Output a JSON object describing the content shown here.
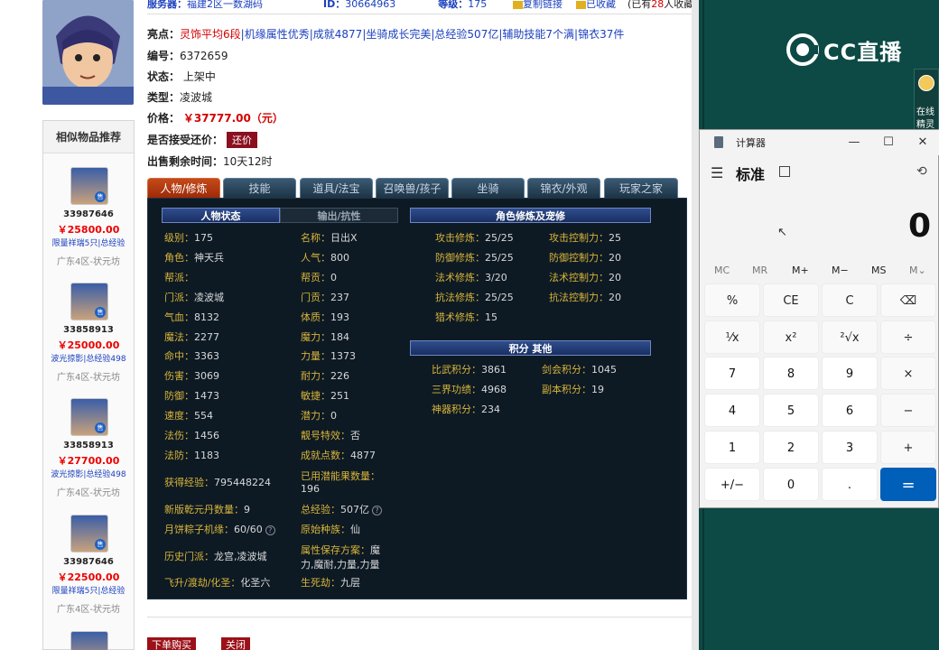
{
  "header": {
    "server_label": "服务器：",
    "server_value": "福建2区一数湖码",
    "id_label": "ID：",
    "id_value": "30664963",
    "level_label": "等级：",
    "level_value": "175",
    "copy_link": "复制链接",
    "favorited": "已收藏",
    "fav_count_prefix": "(已有",
    "fav_count": "28",
    "fav_count_suffix": "人收藏)"
  },
  "item": {
    "highlights_label": "亮点：",
    "highlights": [
      "灵饰平均6段",
      "机缘属性优秀",
      "成就4877",
      "坐骑成长完美",
      "总经验507亿",
      "辅助技能7个满",
      "锦衣37件"
    ],
    "serial_label": "编号：",
    "serial_value": "6372659",
    "status_label": "状态：",
    "status_value": "上架中",
    "type_label": "类型：",
    "type_value": "凌波城",
    "price_label": "价格：",
    "price_value": "￥37777.00（元）",
    "bargain_label": "是否接受还价：",
    "bargain_button": "还价",
    "remaining_label": "出售剩余时间：",
    "remaining_value": "10天12时"
  },
  "tabs": [
    "人物/修炼",
    "技能",
    "道具/法宝",
    "召唤兽/孩子",
    "坐骑",
    "锦衣/外观",
    "玩家之家"
  ],
  "panel": {
    "char_status_header": "人物状态",
    "resist_header": "输出/抗性",
    "cultivation_header": "角色修炼及宠修",
    "score_header": "积分 其他",
    "left_stats": [
      {
        "k": "级别：",
        "v": "175"
      },
      {
        "k": "角色：",
        "v": "神天兵"
      },
      {
        "k": "帮派：",
        "v": ""
      },
      {
        "k": "门派：",
        "v": "凌波城"
      },
      {
        "k": "气血：",
        "v": "8132"
      },
      {
        "k": "魔法：",
        "v": "2277"
      },
      {
        "k": "命中：",
        "v": "3363"
      },
      {
        "k": "伤害：",
        "v": "3069"
      },
      {
        "k": "防御：",
        "v": "1473"
      },
      {
        "k": "速度：",
        "v": "554"
      },
      {
        "k": "法伤：",
        "v": "1456"
      },
      {
        "k": "法防：",
        "v": "1183"
      }
    ],
    "mid_stats": [
      {
        "k": "名称：",
        "v": "日出X"
      },
      {
        "k": "人气：",
        "v": "800"
      },
      {
        "k": "帮贡：",
        "v": "0"
      },
      {
        "k": "门贡：",
        "v": "237"
      },
      {
        "k": "体质：",
        "v": "193"
      },
      {
        "k": "魔力：",
        "v": "184"
      },
      {
        "k": "力量：",
        "v": "1373"
      },
      {
        "k": "耐力：",
        "v": "226"
      },
      {
        "k": "敏捷：",
        "v": "251"
      },
      {
        "k": "潜力：",
        "v": "0"
      },
      {
        "k": "靓号特效：",
        "v": "否"
      },
      {
        "k": "成就点数：",
        "v": "4877"
      }
    ],
    "exp_label": "获得经验：",
    "exp_value": "795448224",
    "used_potential_label": "已用潜能果数量：",
    "used_potential_value": "196",
    "qianyuan_label": "新版乾元丹数量：",
    "qianyuan_value": "9",
    "total_exp_label": "总经验：",
    "total_exp_value": "507亿",
    "mooncake_label": "月饼粽子机缘：",
    "mooncake_value": "60/60",
    "race_label": "原始种族：",
    "race_value": "仙",
    "history_label": "历史门派：",
    "history_value": "龙宫,凌波城",
    "attr_scheme_label": "属性保存方案：",
    "attr_scheme_value1": "魔",
    "attr_scheme_value2": "力,魔耐,力量,力量",
    "ascend_label": "飞升/渡劫/化圣：",
    "ascend_value": "化圣六",
    "life_death_label": "生死劫：",
    "life_death_value": "九层",
    "cultivation": [
      {
        "k": "攻击修炼：",
        "v": "25/25",
        "k2": "攻击控制力：",
        "v2": "25"
      },
      {
        "k": "防御修炼：",
        "v": "25/25",
        "k2": "防御控制力：",
        "v2": "20"
      },
      {
        "k": "法术修炼：",
        "v": "3/20",
        "k2": "法术控制力：",
        "v2": "20"
      },
      {
        "k": "抗法修炼：",
        "v": "25/25",
        "k2": "抗法控制力：",
        "v2": "20"
      },
      {
        "k": "猎术修炼：",
        "v": "15",
        "k2": "",
        "v2": ""
      }
    ],
    "scores": [
      {
        "k": "比武积分：",
        "v": "3861",
        "k2": "剑会积分：",
        "v2": "1045"
      },
      {
        "k": "三界功绩：",
        "v": "4968",
        "k2": "副本积分：",
        "v2": "19"
      },
      {
        "k": "神器积分：",
        "v": "234",
        "k2": "",
        "v2": ""
      }
    ]
  },
  "bottom_buttons": {
    "buy": "下单购买",
    "close": "关闭"
  },
  "similar": {
    "title": "相似物品推荐",
    "items": [
      {
        "id": "33987646",
        "price": "￥25800.00",
        "tags": "限量祥瑞5只|总经验",
        "server": "广东4区-状元坊"
      },
      {
        "id": "33858913",
        "price": "￥25000.00",
        "tags": "波光掠影|总经验498",
        "server": "广东4区-状元坊"
      },
      {
        "id": "33858913",
        "price": "￥27700.00",
        "tags": "波光掠影|总经验498",
        "server": "广东4区-状元坊"
      },
      {
        "id": "33987646",
        "price": "￥22500.00",
        "tags": "限量祥瑞5只|总经验",
        "server": "广东4区-状元坊"
      }
    ],
    "badge": "售"
  },
  "cc": {
    "logo_text": "CC直播",
    "side_text1": "在线",
    "side_text2": "精灵"
  },
  "calculator": {
    "window_title": "计算器",
    "mode": "标准",
    "display": "0",
    "memory_keys": [
      "MC",
      "MR",
      "M+",
      "M−",
      "MS",
      "M⌄"
    ],
    "keys": [
      "%",
      "CE",
      "C",
      "⌫",
      "⅟x",
      "x²",
      "²√x",
      "÷",
      "7",
      "8",
      "9",
      "×",
      "4",
      "5",
      "6",
      "−",
      "1",
      "2",
      "3",
      "+",
      "+/−",
      "0",
      ".",
      "="
    ]
  }
}
